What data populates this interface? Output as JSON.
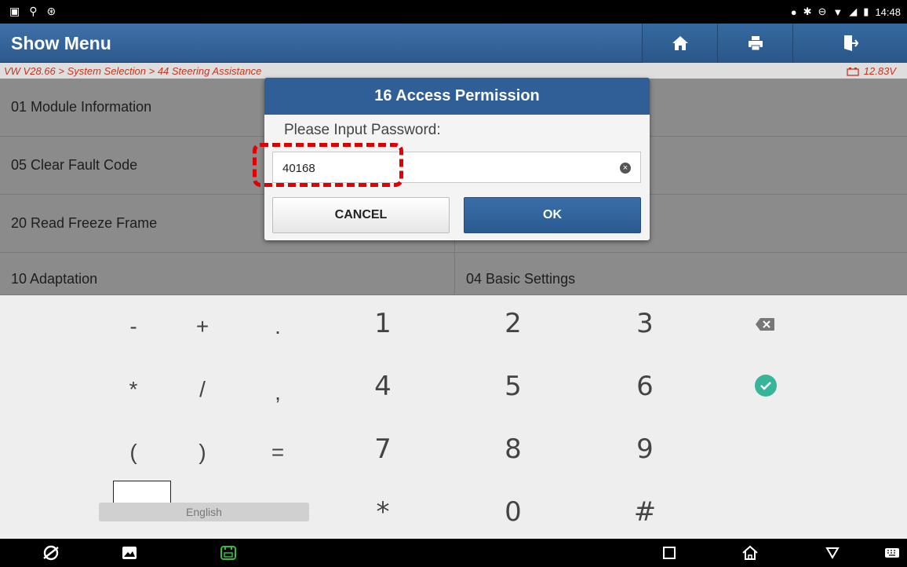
{
  "status": {
    "time": "14:48"
  },
  "header": {
    "title": "Show Menu"
  },
  "breadcrumb": "VW V28.66 > System Selection > 44 Steering Assistance",
  "battery_voltage": "12.83V",
  "menu": {
    "left": [
      "01 Module Information",
      "05 Clear Fault Code",
      "20 Read Freeze Frame",
      "10 Adaptation"
    ],
    "right": [
      "04 Basic Settings"
    ]
  },
  "dialog": {
    "title": "16 Access Permission",
    "prompt": "Please Input Password:",
    "password": "40168",
    "cancel": "CANCEL",
    "ok": "OK"
  },
  "keyboard": {
    "rows": [
      [
        "-",
        "+",
        ".",
        "1",
        "2",
        "3"
      ],
      [
        "*",
        "/",
        ",",
        "4",
        "5",
        "6"
      ],
      [
        "(",
        ")",
        "=",
        "7",
        "8",
        "9"
      ],
      [
        "*",
        "0",
        "#"
      ]
    ],
    "language": "English"
  },
  "colors": {
    "header": "#2f5f96",
    "breadcrumb_text": "#c8341c",
    "highlight": "#e00000",
    "done_key": "#37b59b"
  }
}
